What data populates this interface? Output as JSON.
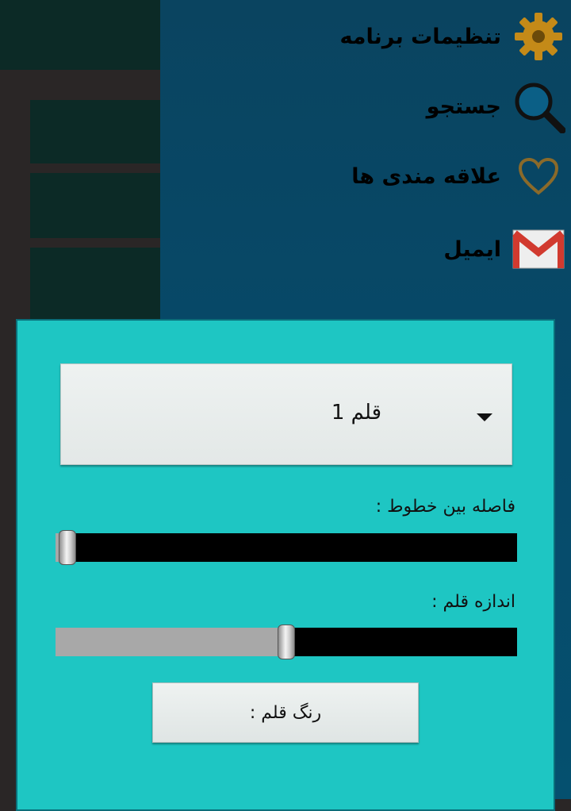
{
  "drawer": {
    "items": [
      {
        "label": "تنظیمات برنامه",
        "icon": "gear-icon"
      },
      {
        "label": "جستجو",
        "icon": "search-icon"
      },
      {
        "label": "علاقه مندی ها",
        "icon": "heart-icon"
      },
      {
        "label": "ایمیل",
        "icon": "mail-icon"
      }
    ]
  },
  "dialog": {
    "spinner_value": "قلم 1",
    "line_spacing_label": "فاصله بین خطوط :",
    "line_spacing_value": 0,
    "pen_size_label": "اندازه قلم :",
    "pen_size_value": 0.5,
    "pen_color_button": "رنگ قلم :"
  },
  "colors": {
    "dialog_bg": "#1ec6c3",
    "drawer_bg": "#064a6a",
    "accent_gold": "#c48a18"
  }
}
